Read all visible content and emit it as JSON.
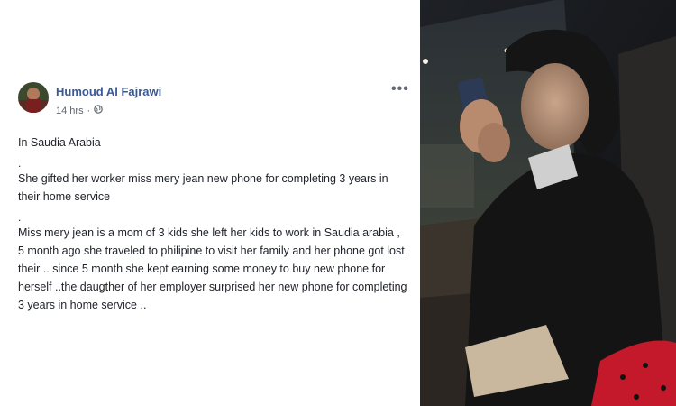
{
  "post": {
    "author": "Humoud Al Fajrawi",
    "time": "14 hrs",
    "audience_icon": "globe-icon",
    "more_icon": "more-options-icon",
    "paragraphs": [
      "In Saudia Arabia",
      ".",
      "She gifted her worker miss mery jean new phone for completing 3 years in their home service",
      ".",
      "Miss mery jean is a mom of 3 kids she left her kids to work in Saudia arabia , 5 month ago she traveled to philipine to visit her family and her phone got lost their .. since 5 month she kept earning some money to buy new phone for herself ..the daugther of her employer surprised her new phone for completing 3 years in home service .."
    ]
  },
  "colors": {
    "author_link": "#385898",
    "meta_text": "#616770",
    "body_text": "#1d2129"
  }
}
